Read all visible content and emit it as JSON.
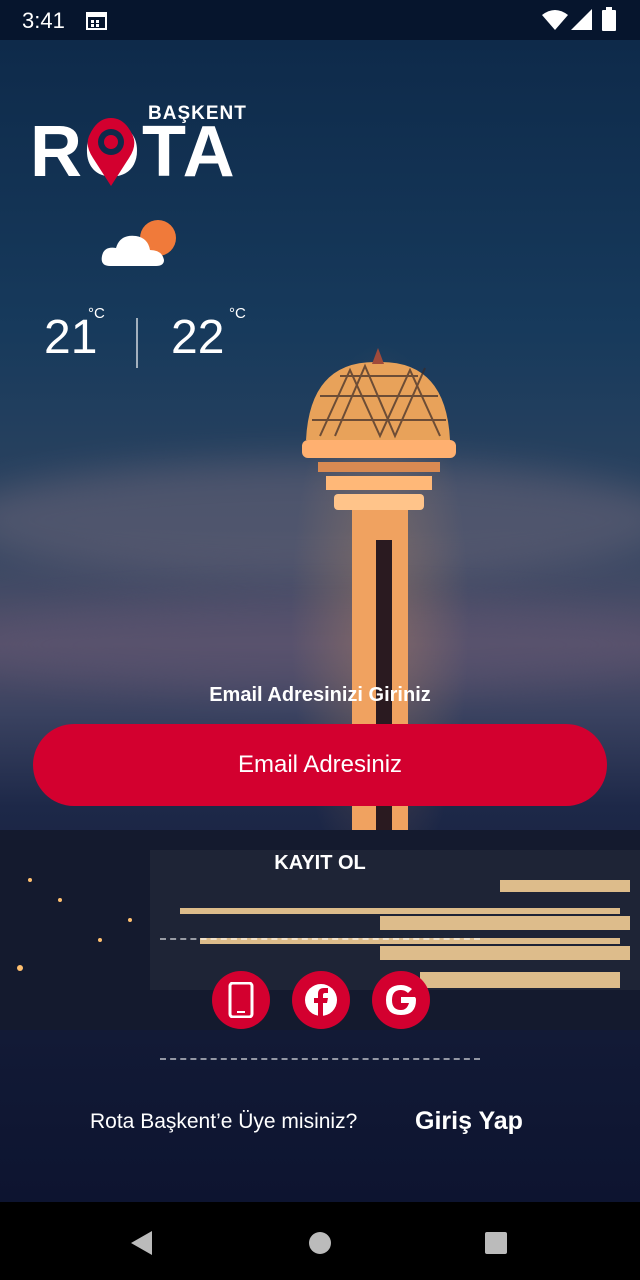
{
  "status_bar": {
    "time": "3:41",
    "icons": [
      "calendar-icon",
      "wifi-icon",
      "signal-icon",
      "battery-icon"
    ]
  },
  "logo": {
    "top_text": "BAŞKENT",
    "main_text": "ROTA"
  },
  "weather": {
    "icon": "partly-cloudy-icon",
    "temp1": "21",
    "unit1": "°C",
    "temp2": "22",
    "unit2": "°C"
  },
  "form": {
    "prompt": "Email Adresinizi Giriniz",
    "email_button": "Email Adresiniz",
    "register": "KAYIT OL"
  },
  "social": {
    "icons": [
      "phone-icon",
      "facebook-icon",
      "google-icon"
    ]
  },
  "footer": {
    "member_question": "Rota Başkent’e Üye misiniz?",
    "login": "Giriş Yap"
  },
  "colors": {
    "accent": "#d3002f",
    "status_bar": "#06152d",
    "nav_bar": "#000000"
  }
}
